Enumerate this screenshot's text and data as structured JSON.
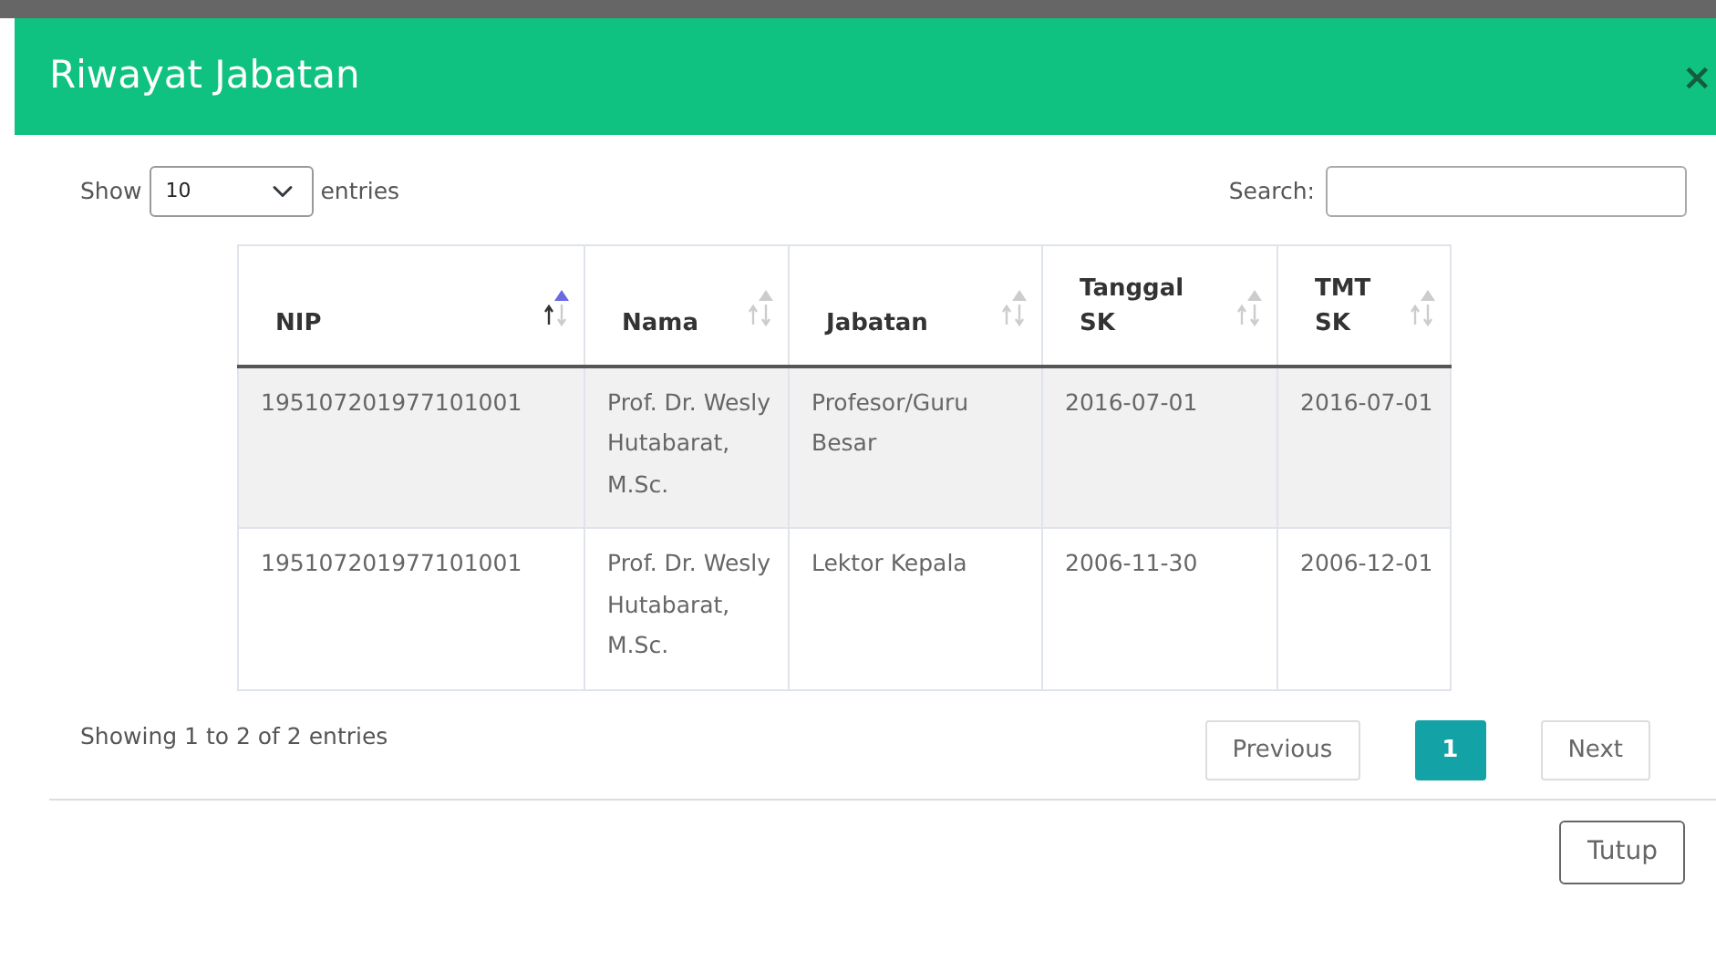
{
  "modal": {
    "title": "Riwayat Jabatan",
    "close": "×"
  },
  "length": {
    "label_before": "Show",
    "value": "10",
    "label_after": "entries"
  },
  "search": {
    "label": "Search:"
  },
  "table": {
    "columns": [
      {
        "label": "NIP",
        "sorted": true
      },
      {
        "label": "Nama",
        "sorted": false
      },
      {
        "label": "Jabatan",
        "sorted": false
      },
      {
        "label": "Tanggal SK",
        "sorted": false
      },
      {
        "label": "TMT SK",
        "sorted": false
      }
    ],
    "rows": [
      {
        "cells": [
          "195107201977101001",
          "Prof. Dr. Wesly Hutabarat, M.Sc.",
          "Profesor/Guru Besar",
          "2016-07-01",
          "2016-07-01"
        ]
      },
      {
        "cells": [
          "195107201977101001",
          "Prof. Dr. Wesly Hutabarat, M.Sc.",
          "Lektor Kepala",
          "2006-11-30",
          "2006-12-01"
        ]
      }
    ]
  },
  "info": "Showing 1 to 2 of 2 entries",
  "pagination": [
    {
      "label": "Previous",
      "selected": false
    },
    {
      "label": "1",
      "selected": true
    },
    {
      "label": "Next",
      "selected": false
    }
  ],
  "footer_button": "Tutup"
}
